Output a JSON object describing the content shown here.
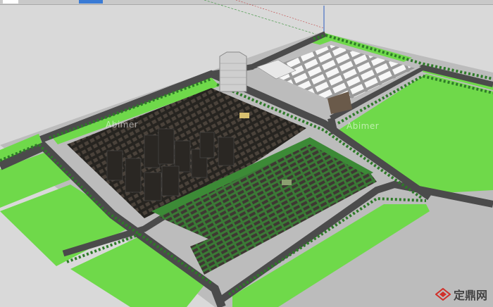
{
  "scene": {
    "colors": {
      "background": "#d9d9d9",
      "road": "#4a4a4a",
      "grass": "#6fd94a",
      "trees": "#2e7a28",
      "buildings": "#3a3530",
      "warehouses": "#f2f2f2",
      "tower": "#cfcfcf",
      "slab": "#bdbdbd"
    }
  },
  "watermarks": {
    "left": "Abimer",
    "right": "Abimer"
  },
  "logo": {
    "brand": "定鼎网",
    "icon": "logo-diamond-icon"
  }
}
